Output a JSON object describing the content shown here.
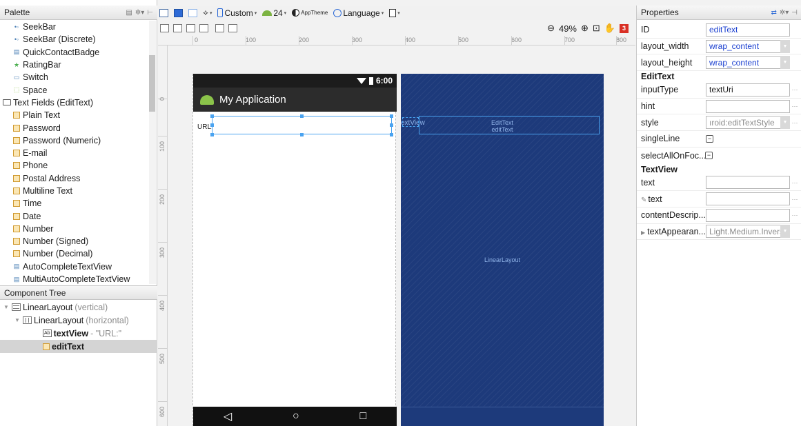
{
  "palette": {
    "title": "Palette",
    "items": [
      {
        "label": "SeekBar",
        "icon": "seekbar-icon"
      },
      {
        "label": "SeekBar (Discrete)",
        "icon": "seekbar-icon"
      },
      {
        "label": "QuickContactBadge",
        "icon": "contact-badge-icon"
      },
      {
        "label": "RatingBar",
        "icon": "star-icon"
      },
      {
        "label": "Switch",
        "icon": "switch-icon"
      },
      {
        "label": "Space",
        "icon": "space-icon"
      },
      {
        "label": "Text Fields (EditText)",
        "icon": "folder-icon"
      },
      {
        "label": "Plain Text",
        "icon": "text-field-icon"
      },
      {
        "label": "Password",
        "icon": "text-field-icon"
      },
      {
        "label": "Password (Numeric)",
        "icon": "text-field-icon"
      },
      {
        "label": "E-mail",
        "icon": "text-field-icon"
      },
      {
        "label": "Phone",
        "icon": "text-field-icon"
      },
      {
        "label": "Postal Address",
        "icon": "text-field-icon"
      },
      {
        "label": "Multiline Text",
        "icon": "text-field-icon"
      },
      {
        "label": "Time",
        "icon": "text-field-icon"
      },
      {
        "label": "Date",
        "icon": "text-field-icon"
      },
      {
        "label": "Number",
        "icon": "text-field-icon"
      },
      {
        "label": "Number (Signed)",
        "icon": "text-field-icon"
      },
      {
        "label": "Number (Decimal)",
        "icon": "text-field-icon"
      },
      {
        "label": "AutoCompleteTextView",
        "icon": "autocomplete-icon"
      },
      {
        "label": "MultiAutoCompleteTextView",
        "icon": "autocomplete-icon"
      }
    ]
  },
  "component_tree": {
    "title": "Component Tree",
    "rows": [
      {
        "name": "LinearLayout",
        "suffix": "(vertical)"
      },
      {
        "name": "LinearLayout",
        "suffix": "(horizontal)"
      },
      {
        "name": "textView",
        "suffix": " - \"URL:\""
      },
      {
        "name": "editText",
        "suffix": ""
      }
    ]
  },
  "toolbar": {
    "device": "Custom",
    "api": "24",
    "theme": "AppTheme",
    "language": "Language"
  },
  "design": {
    "zoom": "49%",
    "warnings": "3",
    "ruler_top": [
      "0",
      "100",
      "200",
      "300",
      "400",
      "500",
      "600",
      "700",
      "800"
    ],
    "ruler_left": [
      "0",
      "100",
      "200",
      "300",
      "400",
      "500",
      "600"
    ],
    "status_time": "6:00",
    "app_title": "My Application",
    "url_label": "URL:",
    "blueprint_textview": "extView",
    "blueprint_edittext_1": "EditText",
    "blueprint_edittext_2": "editText",
    "blueprint_layout": "LinearLayout"
  },
  "properties": {
    "title": "Properties",
    "id_label": "ID",
    "id_value": "editText",
    "layout_width_label": "layout_width",
    "layout_width_value": "wrap_content",
    "layout_height_label": "layout_height",
    "layout_height_value": "wrap_content",
    "edittext_section": "EditText",
    "inputType_label": "inputType",
    "inputType_value": "textUri",
    "hint_label": "hint",
    "hint_value": "",
    "style_label": "style",
    "style_value": "ıroid:editTextStyle",
    "singleLine_label": "singleLine",
    "selectAll_label": "selectAllOnFoc...",
    "textview_section": "TextView",
    "text_label": "text",
    "text_value": "",
    "text2_label": "text",
    "text2_value": "",
    "contentDesc_label": "contentDescrip...",
    "contentDesc_value": "",
    "textAppearance_label": "textAppearan...",
    "textAppearance_value": "Light.Medium.Inverse"
  },
  "colors": {
    "accent": "#2d6ad6",
    "blueprint": "#1d3a7b",
    "selection": "#4aa3f0",
    "warning": "#d93025"
  }
}
